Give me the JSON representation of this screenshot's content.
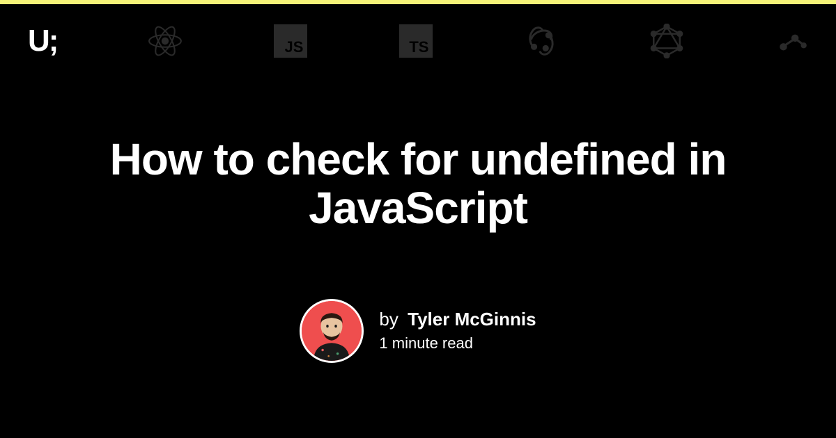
{
  "header": {
    "logo_text": "U;"
  },
  "article": {
    "title": "How to check for undefined in JavaScript",
    "byline_prefix": "by",
    "author_name": "Tyler McGinnis",
    "read_time": "1 minute read"
  },
  "nav_icons": [
    "react",
    "javascript",
    "typescript",
    "redux",
    "graphql",
    "react-query"
  ]
}
